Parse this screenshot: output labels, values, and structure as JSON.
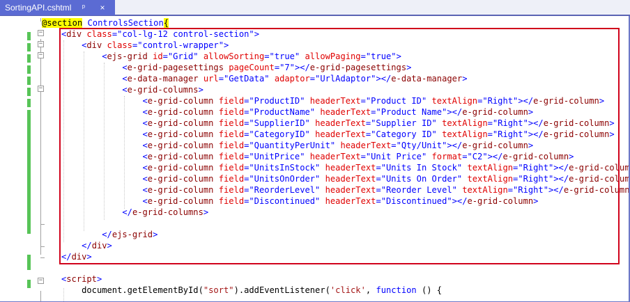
{
  "tab": {
    "filename": "SortingAPI.cshtml",
    "pin_icon": "pin-icon",
    "close_icon": "close-icon",
    "pin_glyph": "ᵖ",
    "close_glyph": "×"
  },
  "colors": {
    "tab_background": "#5b6bd3",
    "change_bar": "#57c457",
    "highlight_border": "#d0021b",
    "tag": "#8b0000",
    "attribute": "#e00000",
    "value": "#0000ff",
    "string": "#a31515",
    "razor_highlight": "#ffff00"
  },
  "code_lines": [
    {
      "tokens": [
        {
          "c": "t-razor",
          "t": "@section"
        },
        {
          "c": "t-plain",
          "t": " "
        },
        {
          "c": "t-section",
          "t": "ControlsSection"
        },
        {
          "c": "t-brace",
          "t": "{"
        }
      ]
    },
    {
      "tokens": [
        {
          "c": "t-punct",
          "t": "<"
        },
        {
          "c": "t-tag",
          "t": "div"
        },
        {
          "c": "t-plain",
          "t": " "
        },
        {
          "c": "t-attr",
          "t": "class"
        },
        {
          "c": "t-punct",
          "t": "="
        },
        {
          "c": "t-val",
          "t": "\"col-lg-12 control-section\""
        },
        {
          "c": "t-punct",
          "t": ">"
        }
      ]
    },
    {
      "tokens": [
        {
          "c": "t-plain",
          "t": "    "
        },
        {
          "c": "t-punct",
          "t": "<"
        },
        {
          "c": "t-tag",
          "t": "div"
        },
        {
          "c": "t-plain",
          "t": " "
        },
        {
          "c": "t-attr",
          "t": "class"
        },
        {
          "c": "t-punct",
          "t": "="
        },
        {
          "c": "t-val",
          "t": "\"control-wrapper\""
        },
        {
          "c": "t-punct",
          "t": ">"
        }
      ]
    },
    {
      "tokens": [
        {
          "c": "t-plain",
          "t": "        "
        },
        {
          "c": "t-punct",
          "t": "<"
        },
        {
          "c": "t-tag",
          "t": "ejs-grid"
        },
        {
          "c": "t-plain",
          "t": " "
        },
        {
          "c": "t-attr",
          "t": "id"
        },
        {
          "c": "t-punct",
          "t": "="
        },
        {
          "c": "t-val",
          "t": "\"Grid\""
        },
        {
          "c": "t-plain",
          "t": " "
        },
        {
          "c": "t-attr",
          "t": "allowSorting"
        },
        {
          "c": "t-punct",
          "t": "="
        },
        {
          "c": "t-val",
          "t": "\"true\""
        },
        {
          "c": "t-plain",
          "t": " "
        },
        {
          "c": "t-attr",
          "t": "allowPaging"
        },
        {
          "c": "t-punct",
          "t": "="
        },
        {
          "c": "t-val",
          "t": "\"true\""
        },
        {
          "c": "t-punct",
          "t": ">"
        }
      ]
    },
    {
      "tokens": [
        {
          "c": "t-plain",
          "t": "            "
        },
        {
          "c": "t-punct",
          "t": "<"
        },
        {
          "c": "t-tag",
          "t": "e-grid-pagesettings"
        },
        {
          "c": "t-plain",
          "t": " "
        },
        {
          "c": "t-attr",
          "t": "pageCount"
        },
        {
          "c": "t-punct",
          "t": "="
        },
        {
          "c": "t-val",
          "t": "\"7\""
        },
        {
          "c": "t-punct",
          "t": "></"
        },
        {
          "c": "t-tag",
          "t": "e-grid-pagesettings"
        },
        {
          "c": "t-punct",
          "t": ">"
        }
      ]
    },
    {
      "tokens": [
        {
          "c": "t-plain",
          "t": "            "
        },
        {
          "c": "t-punct",
          "t": "<"
        },
        {
          "c": "t-tag",
          "t": "e-data-manager"
        },
        {
          "c": "t-plain",
          "t": " "
        },
        {
          "c": "t-attr",
          "t": "url"
        },
        {
          "c": "t-punct",
          "t": "="
        },
        {
          "c": "t-val",
          "t": "\"GetData\""
        },
        {
          "c": "t-plain",
          "t": " "
        },
        {
          "c": "t-attr",
          "t": "adaptor"
        },
        {
          "c": "t-punct",
          "t": "="
        },
        {
          "c": "t-val",
          "t": "\"UrlAdaptor\""
        },
        {
          "c": "t-punct",
          "t": "></"
        },
        {
          "c": "t-tag",
          "t": "e-data-manager"
        },
        {
          "c": "t-punct",
          "t": ">"
        }
      ]
    },
    {
      "tokens": [
        {
          "c": "t-plain",
          "t": "            "
        },
        {
          "c": "t-punct",
          "t": "<"
        },
        {
          "c": "t-tag",
          "t": "e-grid-columns"
        },
        {
          "c": "t-punct",
          "t": ">"
        }
      ]
    },
    {
      "tokens": [
        {
          "c": "t-plain",
          "t": "                "
        },
        {
          "c": "t-punct",
          "t": "<"
        },
        {
          "c": "t-tag",
          "t": "e-grid-column"
        },
        {
          "c": "t-plain",
          "t": " "
        },
        {
          "c": "t-attr",
          "t": "field"
        },
        {
          "c": "t-punct",
          "t": "="
        },
        {
          "c": "t-val",
          "t": "\"ProductID\""
        },
        {
          "c": "t-plain",
          "t": " "
        },
        {
          "c": "t-attr",
          "t": "headerText"
        },
        {
          "c": "t-punct",
          "t": "="
        },
        {
          "c": "t-val",
          "t": "\"Product ID\""
        },
        {
          "c": "t-plain",
          "t": " "
        },
        {
          "c": "t-attr",
          "t": "textAlign"
        },
        {
          "c": "t-punct",
          "t": "="
        },
        {
          "c": "t-val",
          "t": "\"Right\""
        },
        {
          "c": "t-punct",
          "t": "></"
        },
        {
          "c": "t-tag",
          "t": "e-grid-column"
        },
        {
          "c": "t-punct",
          "t": ">"
        }
      ]
    },
    {
      "tokens": [
        {
          "c": "t-plain",
          "t": "                "
        },
        {
          "c": "t-punct",
          "t": "<"
        },
        {
          "c": "t-tag",
          "t": "e-grid-column"
        },
        {
          "c": "t-plain",
          "t": " "
        },
        {
          "c": "t-attr",
          "t": "field"
        },
        {
          "c": "t-punct",
          "t": "="
        },
        {
          "c": "t-val",
          "t": "\"ProductName\""
        },
        {
          "c": "t-plain",
          "t": " "
        },
        {
          "c": "t-attr",
          "t": "headerText"
        },
        {
          "c": "t-punct",
          "t": "="
        },
        {
          "c": "t-val",
          "t": "\"Product Name\""
        },
        {
          "c": "t-punct",
          "t": "></"
        },
        {
          "c": "t-tag",
          "t": "e-grid-column"
        },
        {
          "c": "t-punct",
          "t": ">"
        }
      ]
    },
    {
      "tokens": [
        {
          "c": "t-plain",
          "t": "                "
        },
        {
          "c": "t-punct",
          "t": "<"
        },
        {
          "c": "t-tag",
          "t": "e-grid-column"
        },
        {
          "c": "t-plain",
          "t": " "
        },
        {
          "c": "t-attr",
          "t": "field"
        },
        {
          "c": "t-punct",
          "t": "="
        },
        {
          "c": "t-val",
          "t": "\"SupplierID\""
        },
        {
          "c": "t-plain",
          "t": " "
        },
        {
          "c": "t-attr",
          "t": "headerText"
        },
        {
          "c": "t-punct",
          "t": "="
        },
        {
          "c": "t-val",
          "t": "\"Supplier ID\""
        },
        {
          "c": "t-plain",
          "t": " "
        },
        {
          "c": "t-attr",
          "t": "textAlign"
        },
        {
          "c": "t-punct",
          "t": "="
        },
        {
          "c": "t-val",
          "t": "\"Right\""
        },
        {
          "c": "t-punct",
          "t": "></"
        },
        {
          "c": "t-tag",
          "t": "e-grid-column"
        },
        {
          "c": "t-punct",
          "t": ">"
        }
      ]
    },
    {
      "tokens": [
        {
          "c": "t-plain",
          "t": "                "
        },
        {
          "c": "t-punct",
          "t": "<"
        },
        {
          "c": "t-tag",
          "t": "e-grid-column"
        },
        {
          "c": "t-plain",
          "t": " "
        },
        {
          "c": "t-attr",
          "t": "field"
        },
        {
          "c": "t-punct",
          "t": "="
        },
        {
          "c": "t-val",
          "t": "\"CategoryID\""
        },
        {
          "c": "t-plain",
          "t": " "
        },
        {
          "c": "t-attr",
          "t": "headerText"
        },
        {
          "c": "t-punct",
          "t": "="
        },
        {
          "c": "t-val",
          "t": "\"Category ID\""
        },
        {
          "c": "t-plain",
          "t": " "
        },
        {
          "c": "t-attr",
          "t": "textAlign"
        },
        {
          "c": "t-punct",
          "t": "="
        },
        {
          "c": "t-val",
          "t": "\"Right\""
        },
        {
          "c": "t-punct",
          "t": "></"
        },
        {
          "c": "t-tag",
          "t": "e-grid-column"
        },
        {
          "c": "t-punct",
          "t": ">"
        }
      ]
    },
    {
      "tokens": [
        {
          "c": "t-plain",
          "t": "                "
        },
        {
          "c": "t-punct",
          "t": "<"
        },
        {
          "c": "t-tag",
          "t": "e-grid-column"
        },
        {
          "c": "t-plain",
          "t": " "
        },
        {
          "c": "t-attr",
          "t": "field"
        },
        {
          "c": "t-punct",
          "t": "="
        },
        {
          "c": "t-val",
          "t": "\"QuantityPerUnit\""
        },
        {
          "c": "t-plain",
          "t": " "
        },
        {
          "c": "t-attr",
          "t": "headerText"
        },
        {
          "c": "t-punct",
          "t": "="
        },
        {
          "c": "t-val",
          "t": "\"Qty/Unit\""
        },
        {
          "c": "t-punct",
          "t": "></"
        },
        {
          "c": "t-tag",
          "t": "e-grid-column"
        },
        {
          "c": "t-punct",
          "t": ">"
        }
      ]
    },
    {
      "tokens": [
        {
          "c": "t-plain",
          "t": "                "
        },
        {
          "c": "t-punct",
          "t": "<"
        },
        {
          "c": "t-tag",
          "t": "e-grid-column"
        },
        {
          "c": "t-plain",
          "t": " "
        },
        {
          "c": "t-attr",
          "t": "field"
        },
        {
          "c": "t-punct",
          "t": "="
        },
        {
          "c": "t-val",
          "t": "\"UnitPrice\""
        },
        {
          "c": "t-plain",
          "t": " "
        },
        {
          "c": "t-attr",
          "t": "headerText"
        },
        {
          "c": "t-punct",
          "t": "="
        },
        {
          "c": "t-val",
          "t": "\"Unit Price\""
        },
        {
          "c": "t-plain",
          "t": " "
        },
        {
          "c": "t-attr",
          "t": "format"
        },
        {
          "c": "t-punct",
          "t": "="
        },
        {
          "c": "t-val",
          "t": "\"C2\""
        },
        {
          "c": "t-punct",
          "t": "></"
        },
        {
          "c": "t-tag",
          "t": "e-grid-column"
        },
        {
          "c": "t-punct",
          "t": ">"
        }
      ]
    },
    {
      "tokens": [
        {
          "c": "t-plain",
          "t": "                "
        },
        {
          "c": "t-punct",
          "t": "<"
        },
        {
          "c": "t-tag",
          "t": "e-grid-column"
        },
        {
          "c": "t-plain",
          "t": " "
        },
        {
          "c": "t-attr",
          "t": "field"
        },
        {
          "c": "t-punct",
          "t": "="
        },
        {
          "c": "t-val",
          "t": "\"UnitsInStock\""
        },
        {
          "c": "t-plain",
          "t": " "
        },
        {
          "c": "t-attr",
          "t": "headerText"
        },
        {
          "c": "t-punct",
          "t": "="
        },
        {
          "c": "t-val",
          "t": "\"Units In Stock\""
        },
        {
          "c": "t-plain",
          "t": " "
        },
        {
          "c": "t-attr",
          "t": "textAlign"
        },
        {
          "c": "t-punct",
          "t": "="
        },
        {
          "c": "t-val",
          "t": "\"Right\""
        },
        {
          "c": "t-punct",
          "t": "></"
        },
        {
          "c": "t-tag",
          "t": "e-grid-column"
        },
        {
          "c": "t-punct",
          "t": ">"
        }
      ]
    },
    {
      "tokens": [
        {
          "c": "t-plain",
          "t": "                "
        },
        {
          "c": "t-punct",
          "t": "<"
        },
        {
          "c": "t-tag",
          "t": "e-grid-column"
        },
        {
          "c": "t-plain",
          "t": " "
        },
        {
          "c": "t-attr",
          "t": "field"
        },
        {
          "c": "t-punct",
          "t": "="
        },
        {
          "c": "t-val",
          "t": "\"UnitsOnOrder\""
        },
        {
          "c": "t-plain",
          "t": " "
        },
        {
          "c": "t-attr",
          "t": "headerText"
        },
        {
          "c": "t-punct",
          "t": "="
        },
        {
          "c": "t-val",
          "t": "\"Units On Order\""
        },
        {
          "c": "t-plain",
          "t": " "
        },
        {
          "c": "t-attr",
          "t": "textAlign"
        },
        {
          "c": "t-punct",
          "t": "="
        },
        {
          "c": "t-val",
          "t": "\"Right\""
        },
        {
          "c": "t-punct",
          "t": "></"
        },
        {
          "c": "t-tag",
          "t": "e-grid-column"
        },
        {
          "c": "t-punct",
          "t": ">"
        }
      ]
    },
    {
      "tokens": [
        {
          "c": "t-plain",
          "t": "                "
        },
        {
          "c": "t-punct",
          "t": "<"
        },
        {
          "c": "t-tag",
          "t": "e-grid-column"
        },
        {
          "c": "t-plain",
          "t": " "
        },
        {
          "c": "t-attr",
          "t": "field"
        },
        {
          "c": "t-punct",
          "t": "="
        },
        {
          "c": "t-val",
          "t": "\"ReorderLevel\""
        },
        {
          "c": "t-plain",
          "t": " "
        },
        {
          "c": "t-attr",
          "t": "headerText"
        },
        {
          "c": "t-punct",
          "t": "="
        },
        {
          "c": "t-val",
          "t": "\"Reorder Level\""
        },
        {
          "c": "t-plain",
          "t": " "
        },
        {
          "c": "t-attr",
          "t": "textAlign"
        },
        {
          "c": "t-punct",
          "t": "="
        },
        {
          "c": "t-val",
          "t": "\"Right\""
        },
        {
          "c": "t-punct",
          "t": "></"
        },
        {
          "c": "t-tag",
          "t": "e-grid-column"
        },
        {
          "c": "t-punct",
          "t": ">"
        }
      ]
    },
    {
      "tokens": [
        {
          "c": "t-plain",
          "t": "                "
        },
        {
          "c": "t-punct",
          "t": "<"
        },
        {
          "c": "t-tag",
          "t": "e-grid-column"
        },
        {
          "c": "t-plain",
          "t": " "
        },
        {
          "c": "t-attr",
          "t": "field"
        },
        {
          "c": "t-punct",
          "t": "="
        },
        {
          "c": "t-val",
          "t": "\"Discontinued\""
        },
        {
          "c": "t-plain",
          "t": " "
        },
        {
          "c": "t-attr",
          "t": "headerText"
        },
        {
          "c": "t-punct",
          "t": "="
        },
        {
          "c": "t-val",
          "t": "\"Discontinued\""
        },
        {
          "c": "t-punct",
          "t": "></"
        },
        {
          "c": "t-tag",
          "t": "e-grid-column"
        },
        {
          "c": "t-punct",
          "t": ">"
        }
      ]
    },
    {
      "tokens": [
        {
          "c": "t-plain",
          "t": "            "
        },
        {
          "c": "t-punct",
          "t": "</"
        },
        {
          "c": "t-tag",
          "t": "e-grid-columns"
        },
        {
          "c": "t-punct",
          "t": ">"
        }
      ]
    },
    {
      "tokens": []
    },
    {
      "tokens": [
        {
          "c": "t-plain",
          "t": "        "
        },
        {
          "c": "t-punct",
          "t": "</"
        },
        {
          "c": "t-tag",
          "t": "ejs-grid"
        },
        {
          "c": "t-punct",
          "t": ">"
        }
      ]
    },
    {
      "tokens": [
        {
          "c": "t-plain",
          "t": "    "
        },
        {
          "c": "t-punct",
          "t": "</"
        },
        {
          "c": "t-tag",
          "t": "div"
        },
        {
          "c": "t-punct",
          "t": ">"
        }
      ]
    },
    {
      "tokens": [
        {
          "c": "t-punct",
          "t": "</"
        },
        {
          "c": "t-tag",
          "t": "div"
        },
        {
          "c": "t-punct",
          "t": ">"
        }
      ]
    },
    {
      "tokens": []
    },
    {
      "tokens": [
        {
          "c": "t-punct",
          "t": "<"
        },
        {
          "c": "t-tag",
          "t": "script"
        },
        {
          "c": "t-punct",
          "t": ">"
        }
      ]
    },
    {
      "tokens": [
        {
          "c": "t-plain",
          "t": "    document.getElementById("
        },
        {
          "c": "t-str",
          "t": "\"sort\""
        },
        {
          "c": "t-plain",
          "t": ").addEventListener("
        },
        {
          "c": "t-str",
          "t": "'click'"
        },
        {
          "c": "t-plain",
          "t": ", "
        },
        {
          "c": "t-kw",
          "t": "function"
        },
        {
          "c": "t-plain",
          "t": " () {"
        }
      ]
    },
    {
      "tokens": []
    }
  ]
}
